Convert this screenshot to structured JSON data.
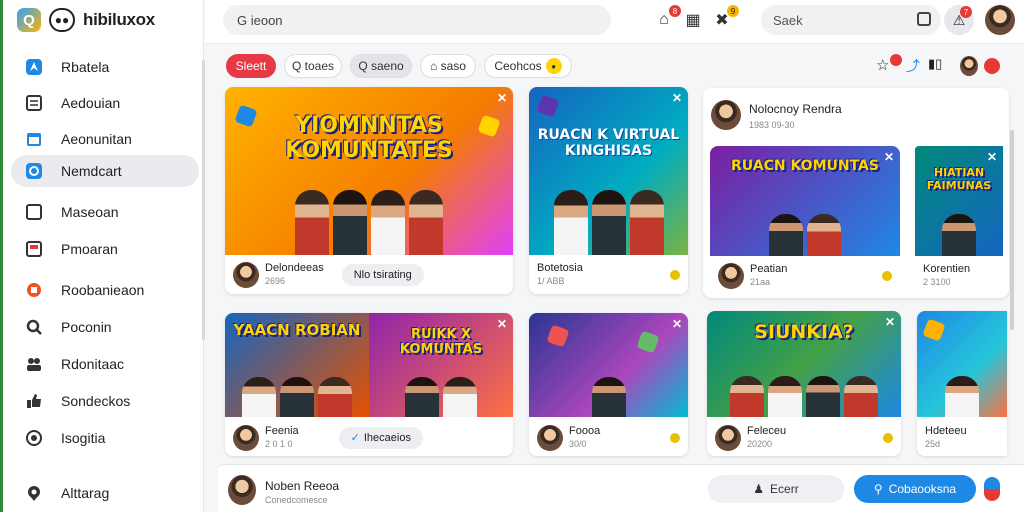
{
  "brand": {
    "name": "hibiluxox"
  },
  "sidebar": {
    "items": [
      {
        "label": "Rbatela",
        "icon": "location-arrow-icon"
      },
      {
        "label": "Aedouian",
        "icon": "list-icon"
      },
      {
        "label": "Aeonunitan",
        "icon": "calendar-icon"
      },
      {
        "label": "Nemdcart",
        "icon": "chat-icon"
      },
      {
        "label": "Maseoan",
        "icon": "square-icon"
      },
      {
        "label": "Pmoaran",
        "icon": "document-icon"
      },
      {
        "label": "Roobanieaon",
        "icon": "megaphone-icon"
      },
      {
        "label": "Poconin",
        "icon": "search-icon"
      },
      {
        "label": "Rdonitaac",
        "icon": "people-icon"
      },
      {
        "label": "Sondeckos",
        "icon": "thumbs-up-icon"
      },
      {
        "label": "Isogitia",
        "icon": "at-icon"
      },
      {
        "label": "Alttarag",
        "icon": "location-pin-icon"
      }
    ]
  },
  "topbar": {
    "search_value": "G ieoon",
    "search2_value": "Saek",
    "badges": {
      "home": "8",
      "apps": "9",
      "bell": "7"
    }
  },
  "chips": [
    {
      "label": "Sleett"
    },
    {
      "label": "Q toaes"
    },
    {
      "label": "Q saeno"
    },
    {
      "label": "⌂ saso"
    },
    {
      "label": "Ceohcos"
    }
  ],
  "cards": [
    {
      "thumb_title": "YIOMNNTAS KOMUNTATES",
      "name": "Delondeeas",
      "sub": "2696",
      "pill": "Nlo tsirating",
      "pill_icon": ""
    },
    {
      "thumb_title": "RUACN K VIRTUAL KINGHISAS",
      "name": "Botetosia",
      "sub": "1/ ABB",
      "pill": "",
      "pill_icon": ""
    },
    {
      "thumb_title": "RUACN KOMUNTAS",
      "name": "Peatian",
      "sub": "21aa",
      "pill": "",
      "pill_icon": ""
    },
    {
      "thumb_title": "HIATIAN FAIMUNAS",
      "name": "Korentien",
      "sub": "2 3100",
      "pill": "",
      "pill_icon": ""
    },
    {
      "thumb_title": "YAACN ROBIAN",
      "name": "Feenia",
      "sub": "2 0 1 0",
      "pill": "Ihecaeios",
      "pill_icon": "✓"
    },
    {
      "thumb_title": "",
      "name": "Foooa",
      "sub": "30/0",
      "pill": "",
      "pill_icon": ""
    },
    {
      "thumb_title": "SIUNKIA?",
      "name": "Feleceu",
      "sub": "20200",
      "pill": "",
      "pill_icon": ""
    },
    {
      "thumb_title": "",
      "name": "Hdeteeu",
      "sub": "25d",
      "pill": "",
      "pill_icon": ""
    }
  ],
  "featured": {
    "name": "Nolocnoy Rendra",
    "sub": "1983 09-30"
  },
  "second_thumb_title": "RUIKK X KOMUNTAS",
  "bottombar": {
    "name": "Noben Reeoa",
    "sub": "Conedcomesce",
    "pill1": "Ecerr",
    "pill2": "Cobaooksna"
  }
}
